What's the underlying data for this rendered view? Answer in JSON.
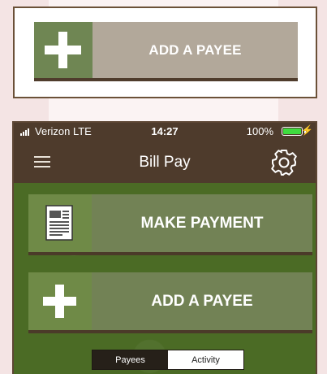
{
  "zoom_card": {
    "label": "ADD A PAYEE",
    "icon": "plus-icon"
  },
  "status_bar": {
    "carrier": "Verizon  LTE",
    "time": "14:27",
    "battery": "100%",
    "battery_level": 1.0,
    "icons": [
      "signal-icon",
      "battery-icon",
      "charging-icon"
    ]
  },
  "nav": {
    "title": "Bill Pay",
    "menu_icon": "hamburger-menu-icon",
    "settings_icon": "gear-icon"
  },
  "actions": [
    {
      "label": "MAKE PAYMENT",
      "icon": "document-icon"
    },
    {
      "label": "ADD A PAYEE",
      "icon": "plus-icon"
    }
  ],
  "segments": {
    "items": [
      "Payees",
      "Activity"
    ],
    "selected": "Activity"
  },
  "colors": {
    "nav_brown": "#4e3b2c",
    "button_green": "#728255",
    "icon_green": "#6f8a47",
    "background_green": "#4b6b25",
    "zoom_button": "#b2a89a"
  }
}
